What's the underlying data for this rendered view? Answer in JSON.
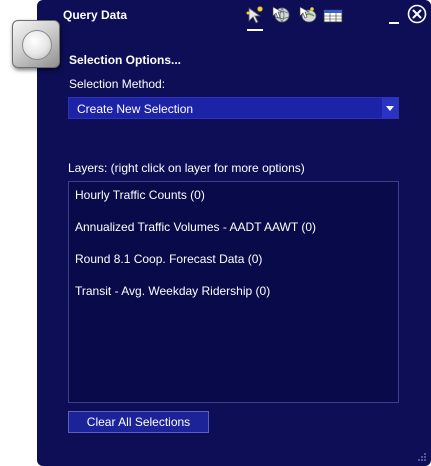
{
  "window": {
    "title": "Query Data"
  },
  "toolbar": {
    "icons": [
      "select-by-shape-icon",
      "select-by-attribute-icon",
      "buffer-select-icon",
      "table-icon"
    ],
    "minimize_glyph": "–",
    "close_glyph": "✕"
  },
  "selection": {
    "heading": "Selection Options...",
    "method_label": "Selection Method:",
    "method_value": "Create New Selection"
  },
  "layers": {
    "label": "Layers:  (right click on layer for more options)",
    "items": [
      "Hourly Traffic Counts (0)",
      "Annualized Traffic Volumes - AADT AAWT (0)",
      "Round 8.1 Coop. Forecast Data (0)",
      "Transit - Avg. Weekday Ridership (0)"
    ]
  },
  "actions": {
    "clear_label": "Clear All Selections"
  },
  "colors": {
    "panel_bg": "#0d0e56",
    "list_bg": "#080a4a",
    "select_bg": "#1c23a6",
    "text": "#ffffff"
  }
}
